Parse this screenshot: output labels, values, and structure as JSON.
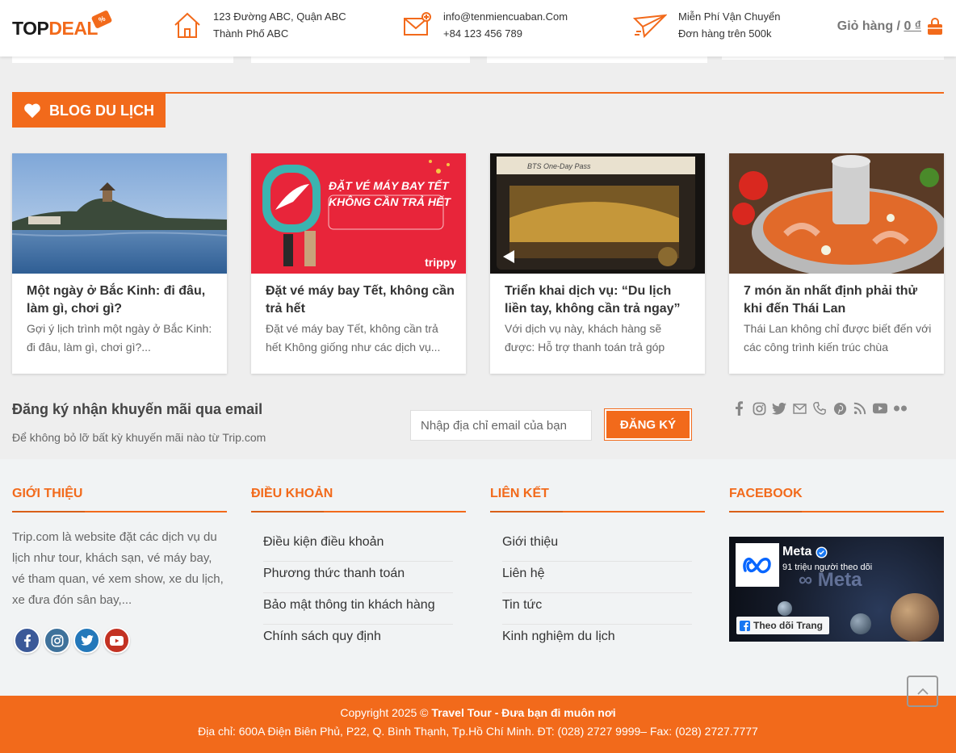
{
  "header": {
    "logo_a": "TOP",
    "logo_b": "DEAL",
    "address_line1": "123 Đường ABC, Quận ABC",
    "address_line2": "Thành Phố ABC",
    "email": "info@tenmiencuaban.Com",
    "phone": "+84 123 456 789",
    "shipping_line1": "Miễn Phí Vận Chuyển",
    "shipping_line2": "Đơn hàng trên 500k",
    "cart_label": "Giỏ hàng /",
    "cart_amount": "0 ₫"
  },
  "blog": {
    "section_title": "BLOG DU LỊCH",
    "posts": [
      {
        "title": "Một ngày ở Bắc Kinh: đi đâu, làm gì, chơi gì?",
        "excerpt": "Gợi ý lịch trình một ngày ở Bắc Kinh: đi đâu, làm gì, chơi gì?..."
      },
      {
        "title": "Đặt vé máy bay Tết, không cần trả hết",
        "excerpt": "Đặt vé máy bay Tết, không cần trả hết Không giống như các dịch vụ..."
      },
      {
        "title": "Triển khai dịch vụ: “Du lịch liền tay, không cần trả ngay”",
        "excerpt": "Với dịch vụ này, khách hàng sẽ được: Hỗ trợ thanh toán trả góp"
      },
      {
        "title": "7 món ăn nhất định phải thử khi đến Thái Lan",
        "excerpt": "Thái Lan không chỉ được biết đến với các công trình kiến trúc chùa"
      }
    ],
    "card2_banner_line1": "ĐẶT VÉ MÁY BAY TẾT",
    "card2_banner_line2": "KHÔNG CẦN TRẢ HẾT",
    "card2_brand": "trippy",
    "card3_pass": "BTS One-Day Pass"
  },
  "newsletter": {
    "title": "Đăng ký nhận khuyến mãi qua email",
    "subtitle": "Để không bỏ lỡ bất kỳ khuyến mãi nào từ Trip.com",
    "placeholder": "Nhập địa chỉ email của bạn",
    "button": "ĐĂNG KÝ"
  },
  "footer": {
    "about_title": "GIỚI THIỆU",
    "about_text": "Trip.com là website đặt các dịch vụ du lịch như tour, khách sạn, vé máy bay, vé tham quan, vé xem show, xe du lịch, xe đưa đón sân bay,...",
    "terms_title": "ĐIỀU KHOẢN",
    "terms": [
      "Điều kiện điều khoản",
      "Phương thức thanh toán",
      "Bảo mật thông tin khách hàng",
      "Chính sách quy định"
    ],
    "links_title": "LIÊN KẾT",
    "links": [
      "Giới thiệu",
      "Liên hệ",
      "Tin tức",
      "Kinh nghiệm du lịch"
    ],
    "facebook_title": "FACEBOOK",
    "fb_page_name": "Meta",
    "fb_followers": "91 triệu người theo dõi",
    "fb_follow_button": "Theo dõi Trang",
    "fb_watermark": "∞ Meta"
  },
  "copyright": {
    "prefix": "Copyright 2025 ©",
    "brand": "Travel Tour - Đưa bạn đi muôn nơi",
    "address": "Địa chỉ: 600A Điện Biên Phủ, P22, Q. Bình Thạnh, Tp.Hồ Chí Minh. ĐT: (028) 2727 9999– Fax: (028) 2727.7777"
  },
  "colors": {
    "accent": "#f26a1b",
    "facebook": "#3b5998",
    "instagram": "#3f729b",
    "twitter": "#2478ba",
    "youtube": "#c33223"
  },
  "icons": [
    "home-icon",
    "mail-icon",
    "plane-icon",
    "shopping-bag-icon",
    "heart-icon",
    "facebook-icon",
    "instagram-icon",
    "twitter-icon",
    "envelope-icon",
    "phone-icon",
    "pinterest-icon",
    "rss-icon",
    "youtube-icon",
    "flickr-icon",
    "chevron-up-icon"
  ]
}
